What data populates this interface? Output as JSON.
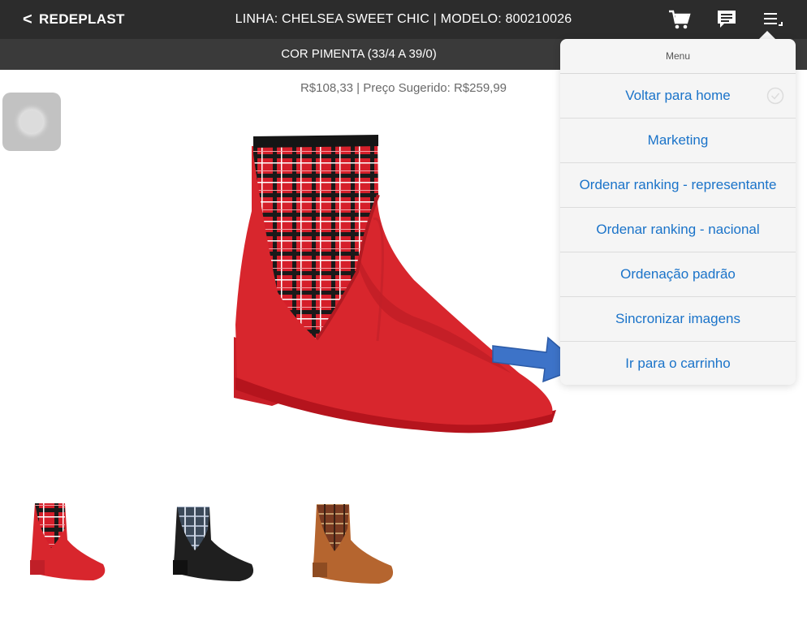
{
  "topbar": {
    "back_label": "REDEPLAST",
    "title": "LINHA: CHELSEA SWEET CHIC | MODELO: 800210026",
    "icons": [
      "cart-icon",
      "chat-icon",
      "menu-icon"
    ]
  },
  "subbar": {
    "label": "COR PIMENTA (33/4 A 39/0)"
  },
  "product": {
    "price_line": "R$108,33 | Preço Sugerido: R$259,99",
    "thumbnails": [
      "red-boot",
      "black-boot",
      "brown-boot"
    ]
  },
  "menu": {
    "header": "Menu",
    "items": [
      "Voltar para home",
      "Marketing",
      "Ordenar ranking - representante",
      "Ordenar ranking - nacional",
      "Ordenação padrão",
      "Sincronizar imagens",
      "Ir para o carrinho"
    ]
  },
  "colors": {
    "topbar": "#2c2c2c",
    "subbar": "#3a3a3a",
    "menu_link": "#1a73c9",
    "boot_red": "#d8262d",
    "arrow_blue": "#3d73c8"
  }
}
